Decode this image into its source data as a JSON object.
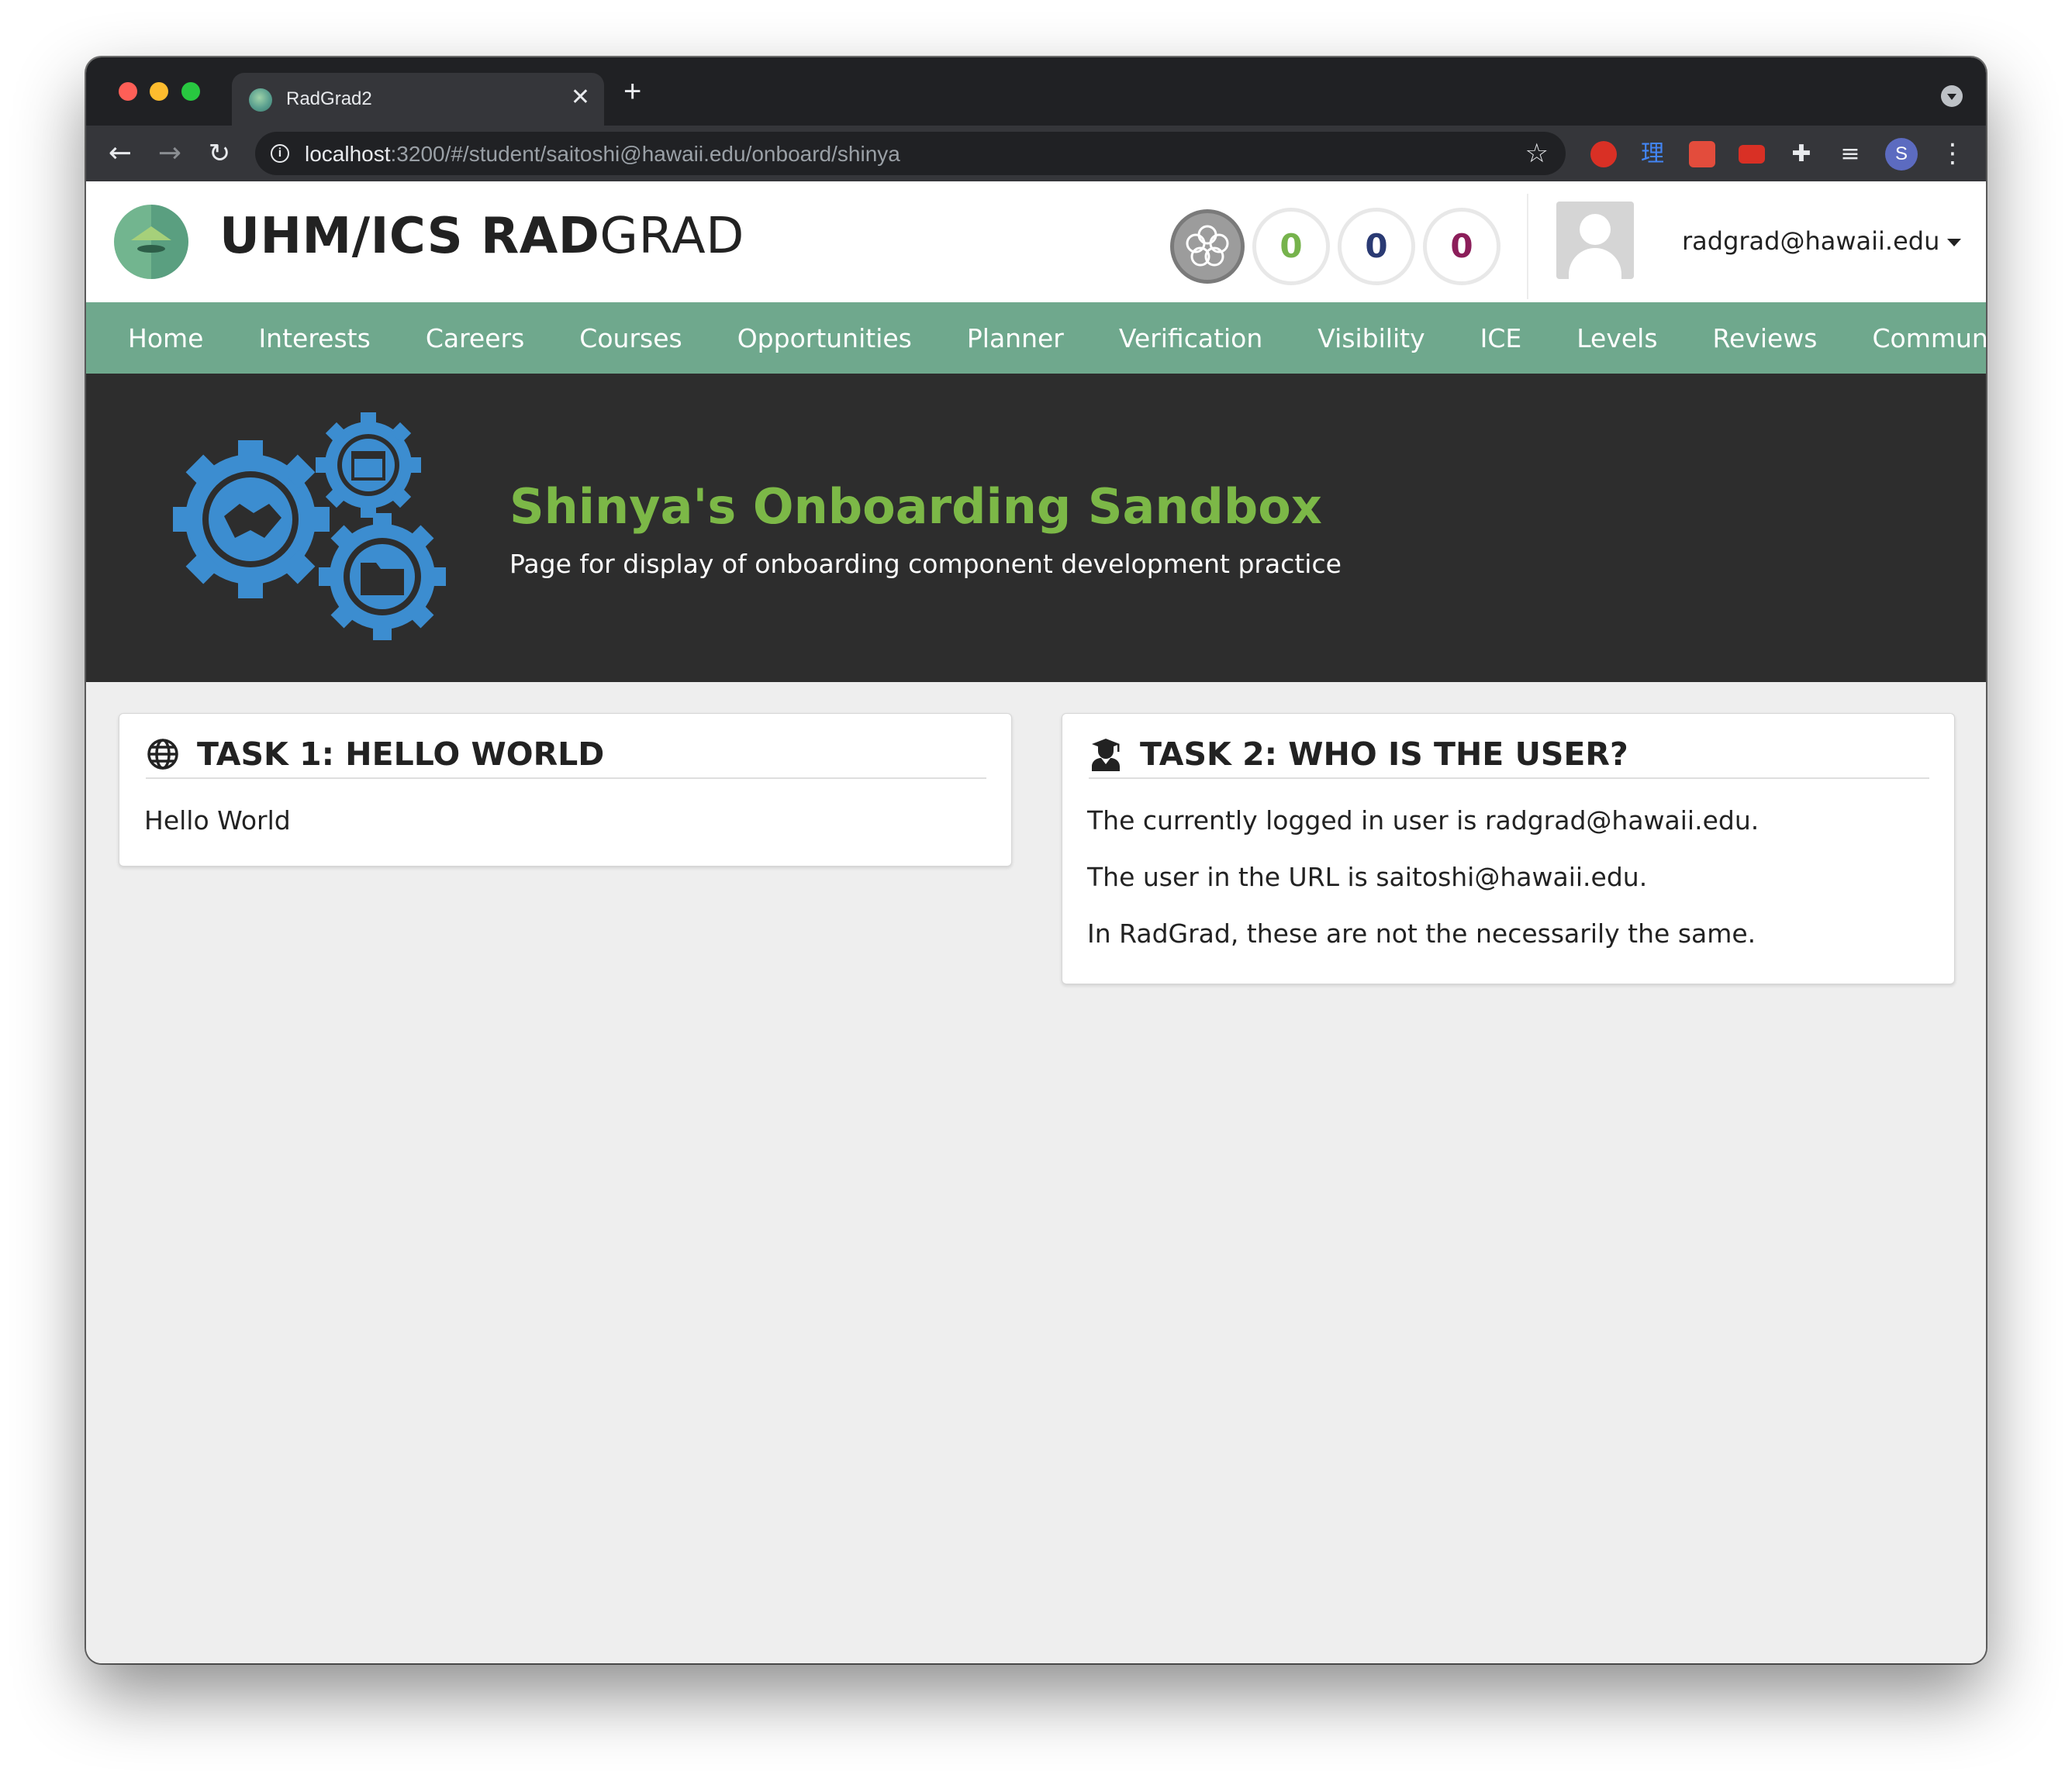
{
  "browser": {
    "tab_title": "RadGrad2",
    "tab_close": "✕",
    "new_tab": "+",
    "url_host": "localhost",
    "url_rest": ":3200/#/student/saitoshi@hawaii.edu/onboard/shinya",
    "profile_initial": "S",
    "extension_glyph": "理"
  },
  "header": {
    "brand_bold": "UHM/ICS RAD",
    "brand_light": "GRAD",
    "ice": {
      "innovation": "0",
      "competency": "0",
      "experience": "0"
    },
    "user_email": "radgrad@hawaii.edu"
  },
  "menu": {
    "items": [
      "Home",
      "Interests",
      "Careers",
      "Courses",
      "Opportunities",
      "Planner",
      "Verification",
      "Visibility",
      "ICE",
      "Levels",
      "Reviews",
      "Community"
    ]
  },
  "banner": {
    "title": "Shinya's Onboarding Sandbox",
    "subtitle": "Page for display of onboarding component development practice"
  },
  "task1": {
    "title": "TASK 1: HELLO WORLD",
    "body": "Hello World",
    "icon": "globe-icon"
  },
  "task2": {
    "title": "TASK 2: WHO IS THE USER?",
    "lines": [
      "The currently logged in user is radgrad@hawaii.edu.",
      "The user in the URL is saitoshi@hawaii.edu.",
      "In RadGrad, these are not the necessarily the same."
    ],
    "icon": "user-graduate-icon"
  },
  "colors": {
    "menu_bg": "#6fa88d",
    "banner_bg": "#2d2d2d",
    "banner_title": "#7cb847",
    "gear_blue": "#3c8dd0",
    "ice_innovation": "#76b34c",
    "ice_competency": "#2a3a73",
    "ice_experience": "#8c1e5a"
  }
}
